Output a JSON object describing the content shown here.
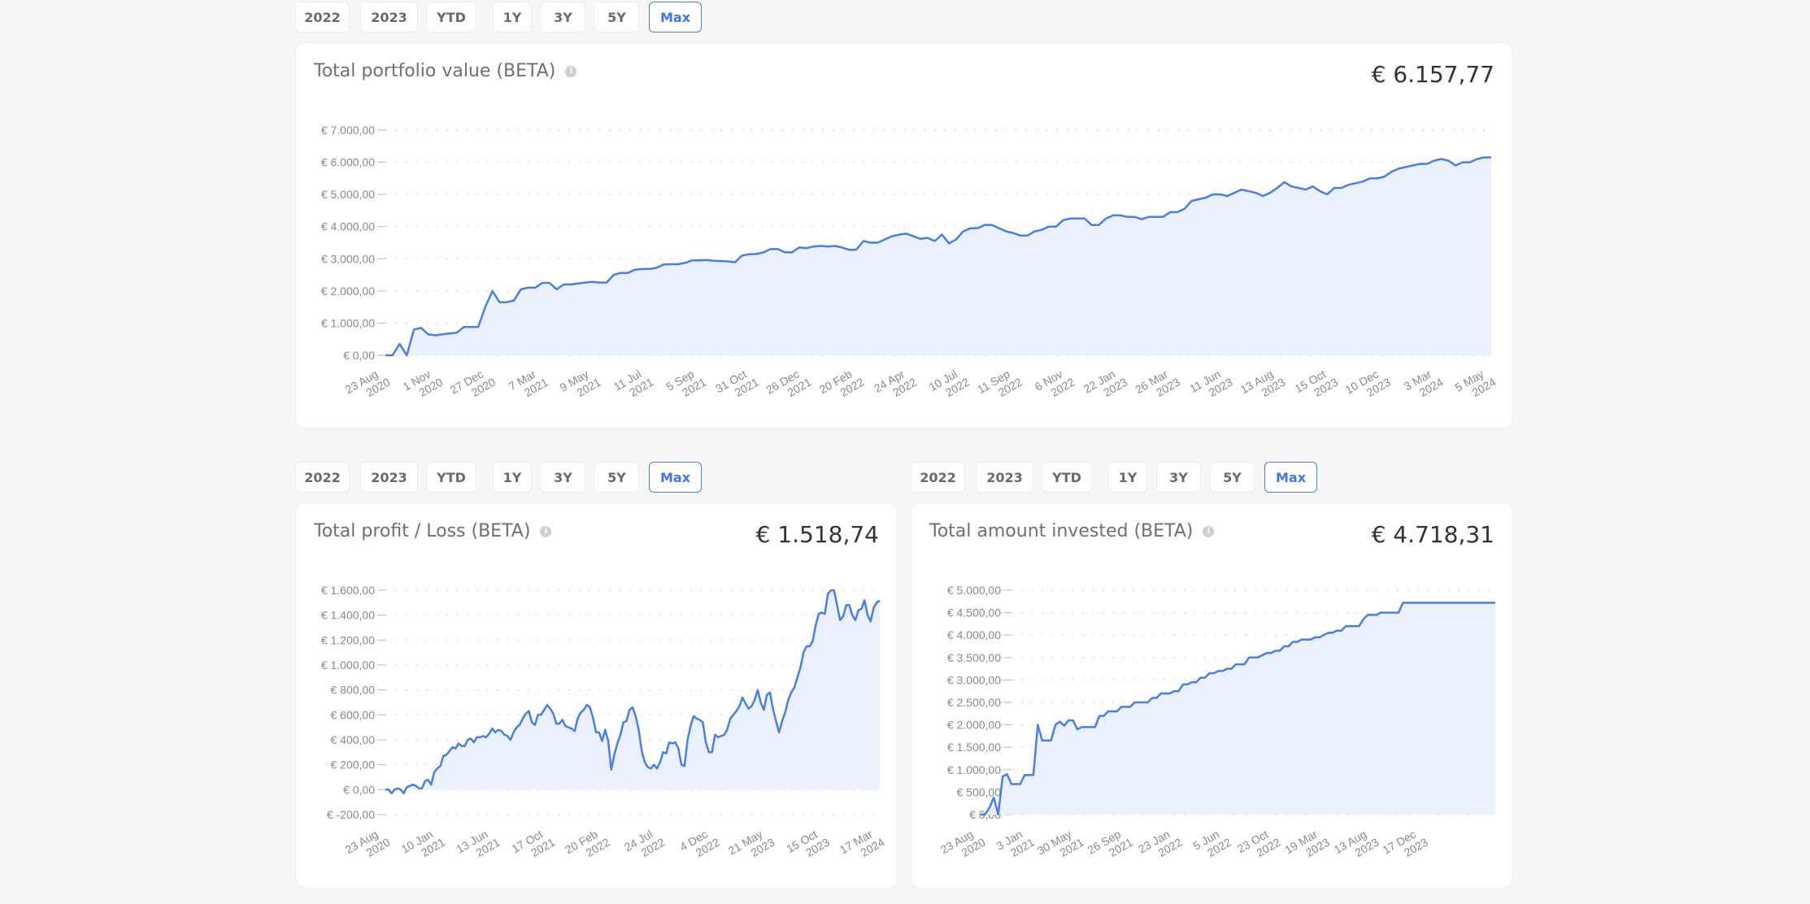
{
  "range_options": [
    "2022",
    "2023",
    "YTD",
    "1Y",
    "3Y",
    "5Y",
    "Max"
  ],
  "active_range": "Max",
  "colors": {
    "line": "#4a7ee8",
    "fill": "#eaf1fd",
    "grid": "#c8c8c8",
    "active": "#3f78e8"
  },
  "cards": {
    "portfolio": {
      "title": "Total portfolio value (BETA)",
      "value": "€ 6.157,77"
    },
    "profit": {
      "title": "Total profit / Loss (BETA)",
      "value": "€ 1.518,74"
    },
    "invested": {
      "title": "Total amount invested (BETA)",
      "value": "€ 4.718,31"
    }
  },
  "chart_data": [
    {
      "id": "portfolio",
      "type": "area",
      "title": "Total portfolio value (BETA)",
      "ylim": [
        0,
        7000
      ],
      "yticks": [
        0,
        1000,
        2000,
        3000,
        4000,
        5000,
        6000,
        7000
      ],
      "ytick_labels": [
        "€ 0,00",
        "€ 1.000,00",
        "€ 2.000,00",
        "€ 3.000,00",
        "€ 4.000,00",
        "€ 5.000,00",
        "€ 6.000,00",
        "€ 7.000,00"
      ],
      "xtick_labels": [
        [
          "23 Aug",
          "2020"
        ],
        [
          "1 Nov",
          "2020"
        ],
        [
          "27 Dec",
          "2020"
        ],
        [
          "7 Mar",
          "2021"
        ],
        [
          "9 May",
          "2021"
        ],
        [
          "11 Jul",
          "2021"
        ],
        [
          "5 Sep",
          "2021"
        ],
        [
          "31 Oct",
          "2021"
        ],
        [
          "26 Dec",
          "2021"
        ],
        [
          "20 Feb",
          "2022"
        ],
        [
          "24 Apr",
          "2022"
        ],
        [
          "10 Jul",
          "2022"
        ],
        [
          "11 Sep",
          "2022"
        ],
        [
          "6 Nov",
          "2022"
        ],
        [
          "22 Jan",
          "2023"
        ],
        [
          "26 Mar",
          "2023"
        ],
        [
          "11 Jun",
          "2023"
        ],
        [
          "13 Aug",
          "2023"
        ],
        [
          "15 Oct",
          "2023"
        ],
        [
          "10 Dec",
          "2023"
        ],
        [
          "3 Mar",
          "2024"
        ],
        [
          "5 May",
          "2024"
        ]
      ],
      "grid": true,
      "values": [
        0,
        0,
        350,
        0,
        800,
        850,
        650,
        620,
        650,
        680,
        700,
        880,
        880,
        880,
        1500,
        2000,
        1650,
        1650,
        1700,
        2050,
        2100,
        2100,
        2250,
        2250,
        2050,
        2200,
        2200,
        2230,
        2260,
        2280,
        2260,
        2260,
        2500,
        2560,
        2560,
        2660,
        2680,
        2680,
        2720,
        2820,
        2830,
        2830,
        2870,
        2950,
        2950,
        2960,
        2940,
        2930,
        2920,
        2890,
        3100,
        3140,
        3150,
        3200,
        3300,
        3300,
        3200,
        3200,
        3350,
        3330,
        3380,
        3400,
        3380,
        3400,
        3350,
        3280,
        3280,
        3550,
        3500,
        3500,
        3600,
        3700,
        3750,
        3780,
        3700,
        3620,
        3650,
        3550,
        3750,
        3480,
        3600,
        3850,
        3950,
        3950,
        4050,
        4050,
        3950,
        3850,
        3800,
        3720,
        3720,
        3850,
        3900,
        4000,
        4000,
        4200,
        4250,
        4250,
        4250,
        4050,
        4050,
        4250,
        4350,
        4350,
        4300,
        4300,
        4230,
        4300,
        4300,
        4300,
        4450,
        4450,
        4550,
        4800,
        4850,
        4900,
        5000,
        5000,
        4950,
        5050,
        5150,
        5100,
        5050,
        4950,
        5050,
        5200,
        5380,
        5250,
        5200,
        5150,
        5250,
        5100,
        5000,
        5200,
        5200,
        5300,
        5350,
        5400,
        5500,
        5500,
        5550,
        5700,
        5800,
        5850,
        5900,
        5950,
        5950,
        6050,
        6100,
        6050,
        5900,
        6000,
        6000,
        6100,
        6150,
        6150
      ]
    },
    {
      "id": "profit",
      "type": "area",
      "title": "Total profit / Loss (BETA)",
      "ylim": [
        -200,
        1600
      ],
      "yticks": [
        -200,
        0,
        200,
        400,
        600,
        800,
        1000,
        1200,
        1400,
        1600
      ],
      "ytick_labels": [
        "€ -200,00",
        "€ 0,00",
        "€ 200,00",
        "€ 400,00",
        "€ 600,00",
        "€ 800,00",
        "€ 1.000,00",
        "€ 1.200,00",
        "€ 1.400,00",
        "€ 1.600,00"
      ],
      "xtick_labels": [
        [
          "23 Aug",
          "2020"
        ],
        [
          "10 Jan",
          "2021"
        ],
        [
          "13 Jun",
          "2021"
        ],
        [
          "17 Oct",
          "2021"
        ],
        [
          "20 Feb",
          "2022"
        ],
        [
          "24 Jul",
          "2022"
        ],
        [
          "4 Dec",
          "2022"
        ],
        [
          "21 May",
          "2023"
        ],
        [
          "15 Oct",
          "2023"
        ],
        [
          "17 Mar",
          "2024"
        ]
      ],
      "grid": true,
      "values": [
        0,
        0,
        -30,
        0,
        10,
        0,
        -30,
        20,
        30,
        40,
        30,
        10,
        10,
        70,
        80,
        40,
        140,
        170,
        190,
        270,
        280,
        310,
        340,
        330,
        370,
        350,
        350,
        400,
        410,
        380,
        420,
        420,
        430,
        420,
        450,
        490,
        460,
        480,
        470,
        440,
        430,
        400,
        460,
        500,
        520,
        570,
        610,
        630,
        540,
        520,
        600,
        600,
        640,
        680,
        650,
        610,
        530,
        530,
        560,
        510,
        500,
        490,
        470,
        570,
        620,
        640,
        680,
        660,
        580,
        460,
        460,
        390,
        480,
        390,
        160,
        280,
        370,
        440,
        540,
        550,
        640,
        660,
        590,
        480,
        310,
        220,
        180,
        170,
        200,
        170,
        220,
        300,
        290,
        380,
        370,
        380,
        330,
        200,
        190,
        400,
        510,
        590,
        570,
        560,
        540,
        380,
        300,
        300,
        440,
        420,
        430,
        440,
        480,
        570,
        600,
        630,
        670,
        740,
        690,
        650,
        670,
        720,
        800,
        700,
        640,
        760,
        780,
        650,
        550,
        460,
        550,
        620,
        720,
        780,
        820,
        900,
        980,
        1100,
        1150,
        1150,
        1190,
        1320,
        1410,
        1420,
        1410,
        1570,
        1600,
        1600,
        1480,
        1360,
        1390,
        1480,
        1480,
        1400,
        1360,
        1440,
        1450,
        1520,
        1400,
        1350,
        1460,
        1500,
        1518
      ]
    },
    {
      "id": "invested",
      "type": "area",
      "title": "Total amount invested (BETA)",
      "ylim": [
        0,
        5000
      ],
      "yticks": [
        0,
        500,
        1000,
        1500,
        2000,
        2500,
        3000,
        3500,
        4000,
        4500,
        5000
      ],
      "ytick_labels": [
        "€ 0,00",
        "€ 500,00",
        "€ 1.000,00",
        "€ 1.500,00",
        "€ 2.000,00",
        "€ 2.500,00",
        "€ 3.000,00",
        "€ 3.500,00",
        "€ 4.000,00",
        "€ 4.500,00",
        "€ 5.000,00"
      ],
      "xtick_labels": [
        [
          "23 Aug",
          "2020"
        ],
        [
          "3 Jan",
          "2021"
        ],
        [
          "30 May",
          "2021"
        ],
        [
          "26 Sep",
          "2021"
        ],
        [
          "23 Jan",
          "2022"
        ],
        [
          "5 Jun",
          "2022"
        ],
        [
          "23 Oct",
          "2022"
        ],
        [
          "19 Mar",
          "2023"
        ],
        [
          "13 Aug",
          "2023"
        ],
        [
          "17 Dec",
          "2023"
        ]
      ],
      "grid": true,
      "values": [
        0,
        0,
        150,
        380,
        0,
        850,
        900,
        680,
        680,
        680,
        880,
        880,
        880,
        2000,
        1650,
        1650,
        1650,
        2000,
        2070,
        1980,
        2100,
        2100,
        1900,
        1950,
        1950,
        1950,
        1950,
        2200,
        2200,
        2300,
        2300,
        2300,
        2400,
        2400,
        2400,
        2500,
        2500,
        2500,
        2500,
        2600,
        2600,
        2700,
        2700,
        2700,
        2750,
        2750,
        2900,
        2900,
        2950,
        2950,
        3050,
        3050,
        3150,
        3150,
        3200,
        3200,
        3250,
        3250,
        3350,
        3350,
        3350,
        3500,
        3500,
        3500,
        3550,
        3600,
        3600,
        3650,
        3650,
        3750,
        3750,
        3850,
        3850,
        3900,
        3900,
        3900,
        3950,
        3950,
        4000,
        4050,
        4050,
        4100,
        4100,
        4200,
        4200,
        4200,
        4200,
        4350,
        4450,
        4450,
        4450,
        4500,
        4500,
        4500,
        4500,
        4500,
        4720,
        4720,
        4720,
        4720,
        4720,
        4720,
        4720,
        4720,
        4720,
        4720,
        4720,
        4720,
        4720,
        4720,
        4720,
        4720,
        4720,
        4720,
        4720,
        4720,
        4720,
        4720
      ]
    }
  ]
}
